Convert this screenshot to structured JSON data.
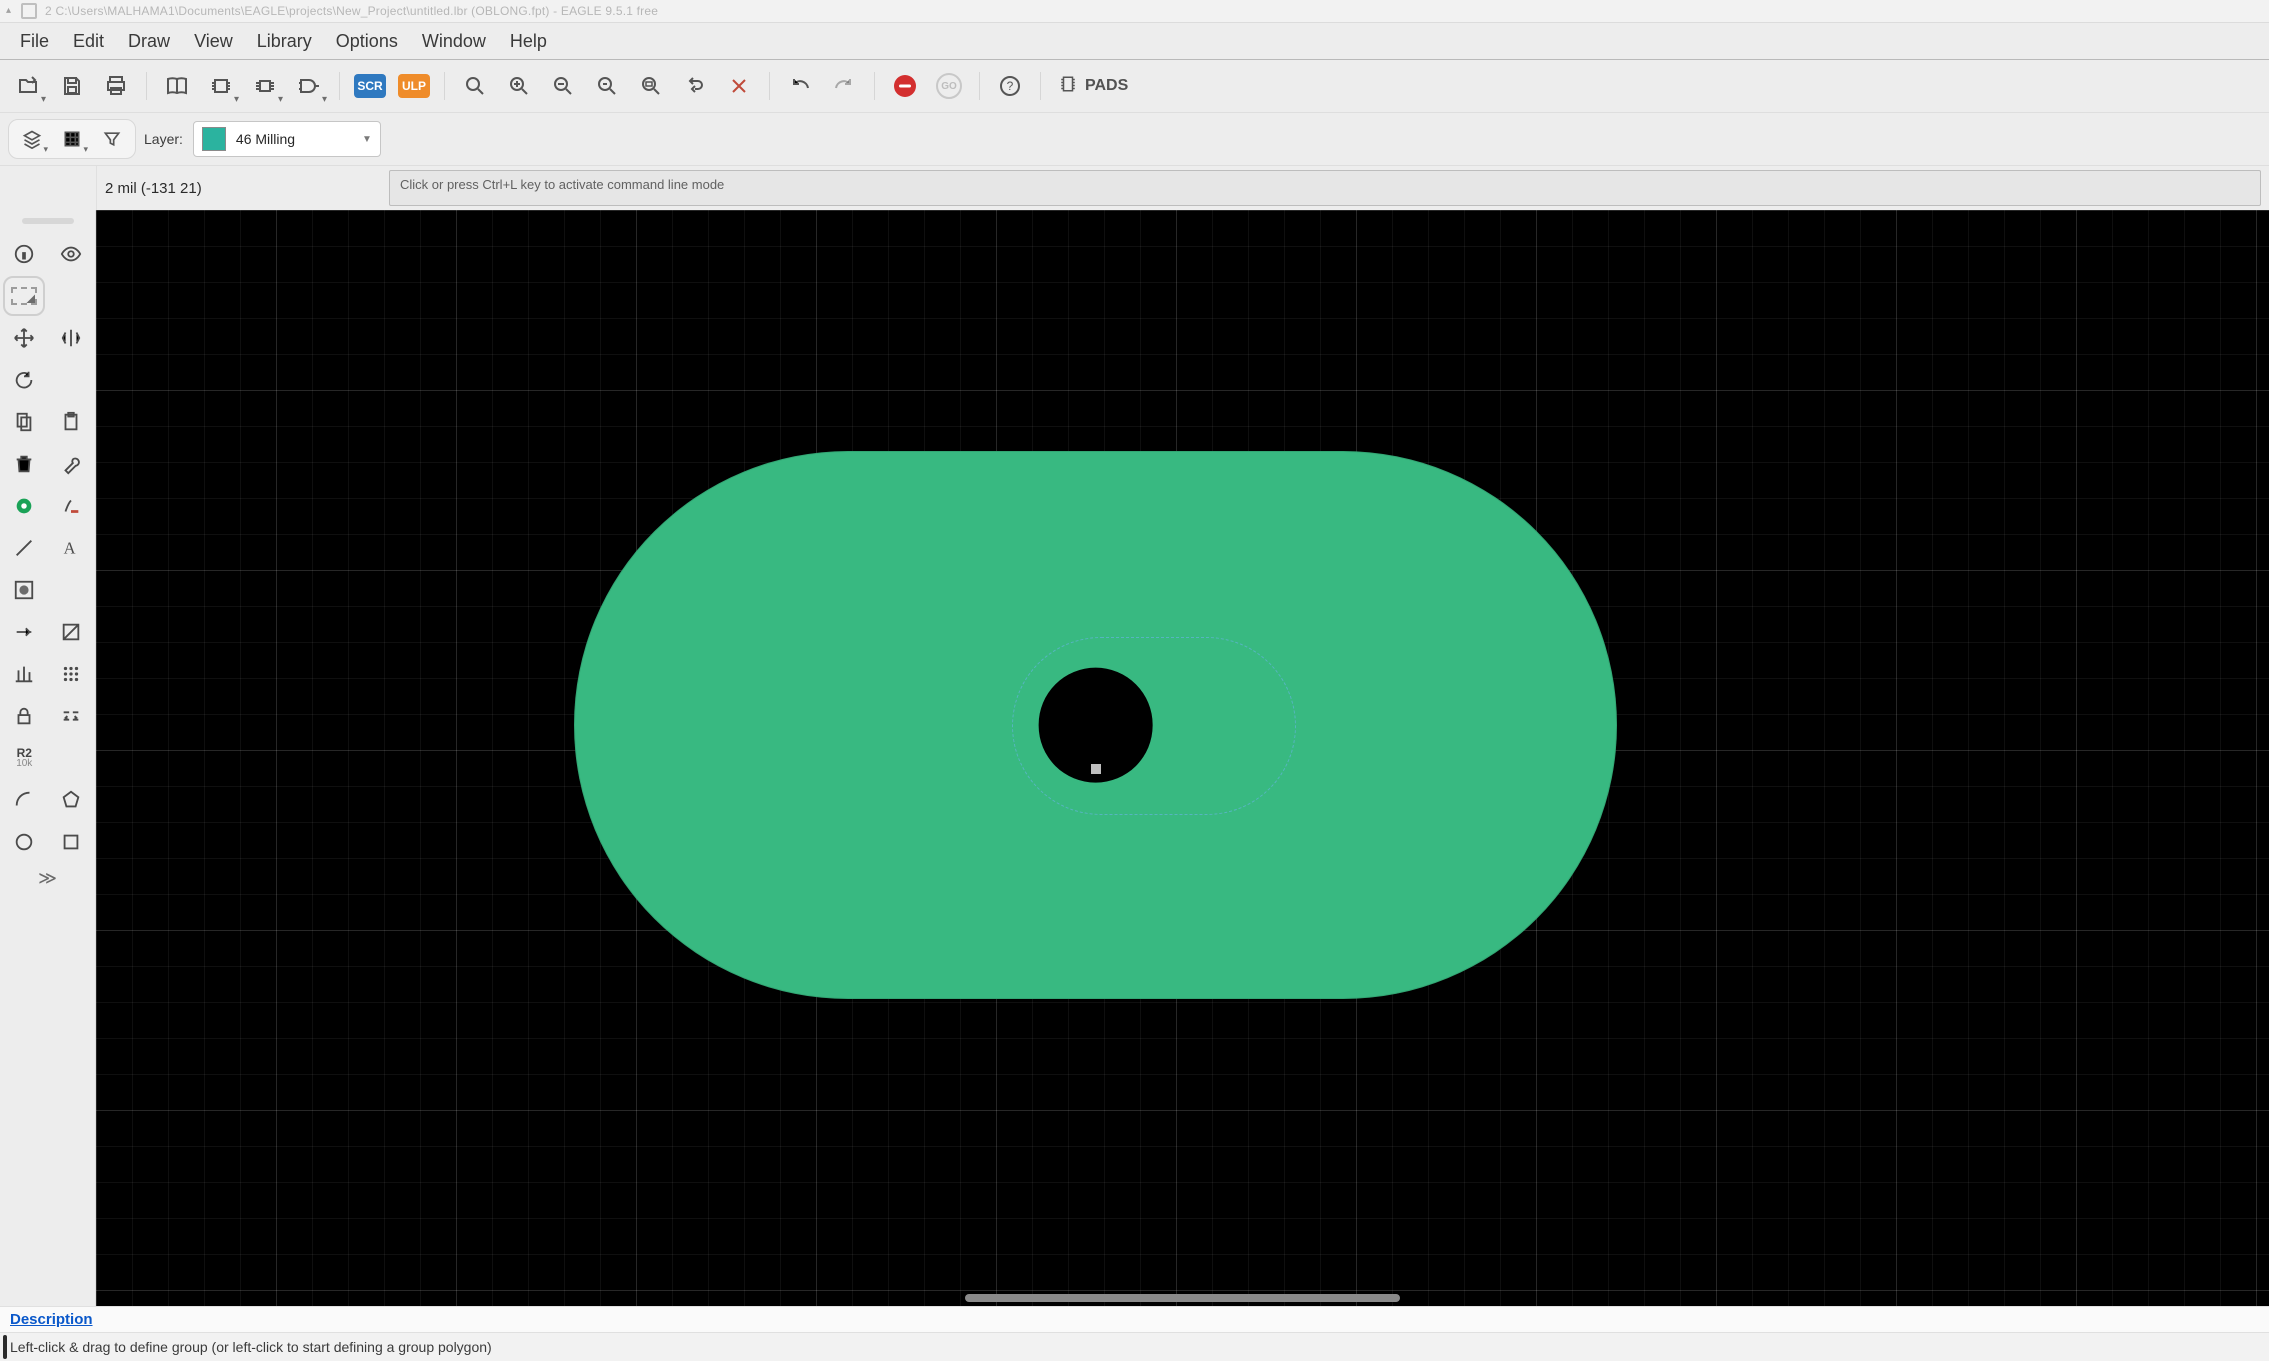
{
  "title": "2 C:\\Users\\MALHAMA1\\Documents\\EAGLE\\projects\\New_Project\\untitled.lbr (OBLONG.fpt) - EAGLE 9.5.1 free",
  "menu": [
    "File",
    "Edit",
    "Draw",
    "View",
    "Library",
    "Options",
    "Window",
    "Help"
  ],
  "toolbar": {
    "open_label": "Open",
    "save_label": "Save",
    "print_label": "Print",
    "library_label": "Library",
    "scr_label": "SCR",
    "ulp_label": "ULP",
    "go_label": "GO",
    "pads_label": "PADS"
  },
  "layer": {
    "label": "Layer:",
    "value": "46 Milling",
    "swatch_hex": "#2bb39f"
  },
  "coord_text": "2 mil (-131 21)",
  "command_placeholder": "Click or press Ctrl+L key to activate command line mode",
  "description_link": "Description",
  "status_text": "Left-click & drag to define group (or left-click to start defining a group polygon)",
  "palette": {
    "value_label": "R2",
    "value_sub": "10k"
  },
  "canvas": {
    "pad_hex": "#38b981"
  }
}
